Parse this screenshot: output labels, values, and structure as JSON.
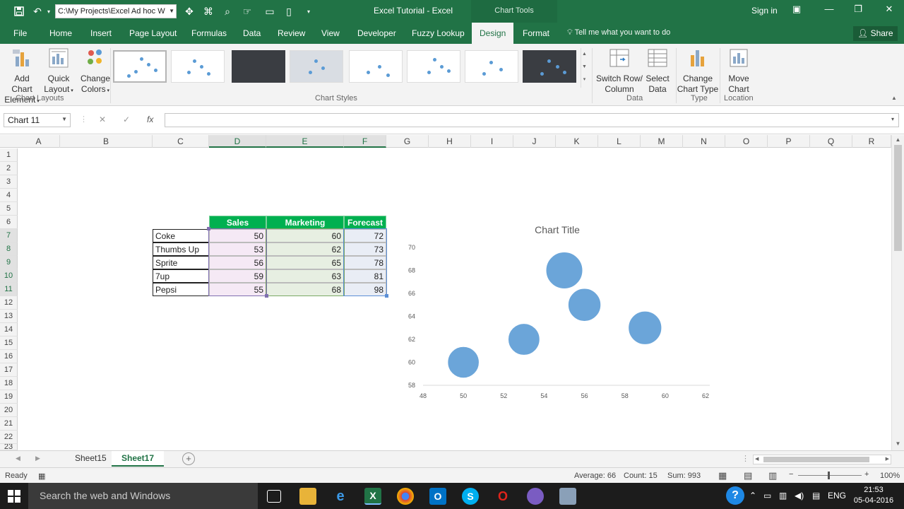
{
  "titlebar": {
    "path": "C:\\My Projects\\Excel Ad hoc W",
    "app_title": "Excel Tutorial  -  Excel",
    "context_title": "Chart Tools",
    "signin": "Sign in"
  },
  "tabs": {
    "items": [
      "File",
      "Home",
      "Insert",
      "Page Layout",
      "Formulas",
      "Data",
      "Review",
      "View",
      "Developer",
      "Fuzzy Lookup",
      "Design",
      "Format"
    ],
    "active": "Design",
    "tellme": "Tell me what you want to do",
    "share": "Share"
  },
  "ribbon": {
    "add_chart_1": "Add Chart",
    "add_chart_2": "Element",
    "quick_layout_1": "Quick",
    "quick_layout_2": "Layout",
    "change_colors_1": "Change",
    "change_colors_2": "Colors",
    "switch_row_1": "Switch Row/",
    "switch_row_2": "Column",
    "select_data_1": "Select",
    "select_data_2": "Data",
    "change_type_1": "Change",
    "change_type_2": "Chart Type",
    "move_chart_1": "Move",
    "move_chart_2": "Chart",
    "group_layouts": "Chart Layouts",
    "group_styles": "Chart Styles",
    "group_data": "Data",
    "group_type": "Type",
    "group_location": "Location"
  },
  "formula": {
    "namebox": "Chart 11",
    "fx": "fx",
    "content": ""
  },
  "columns": [
    "A",
    "B",
    "C",
    "D",
    "E",
    "F",
    "G",
    "H",
    "I",
    "J",
    "K",
    "L",
    "M",
    "N",
    "O",
    "P",
    "Q",
    "R"
  ],
  "rows": [
    "1",
    "2",
    "3",
    "4",
    "5",
    "6",
    "7",
    "8",
    "9",
    "10",
    "11",
    "12",
    "13",
    "14",
    "15",
    "16",
    "17",
    "18",
    "19",
    "20",
    "21",
    "22",
    "23"
  ],
  "table": {
    "headers": [
      "Sales",
      "Marketing",
      "Forecast"
    ],
    "rows": [
      {
        "label": "Coke",
        "sales": "50",
        "marketing": "60",
        "forecast": "72"
      },
      {
        "label": "Thumbs Up",
        "sales": "53",
        "marketing": "62",
        "forecast": "73"
      },
      {
        "label": "Sprite",
        "sales": "56",
        "marketing": "65",
        "forecast": "78"
      },
      {
        "label": "7up",
        "sales": "59",
        "marketing": "63",
        "forecast": "81"
      },
      {
        "label": "Pepsi",
        "sales": "55",
        "marketing": "68",
        "forecast": "98"
      }
    ]
  },
  "chart_data": {
    "type": "bubble",
    "title": "Chart Title",
    "xlabel": "",
    "ylabel": "",
    "xlim": [
      48,
      62
    ],
    "ylim": [
      58,
      70
    ],
    "x_ticks": [
      "48",
      "50",
      "52",
      "54",
      "56",
      "58",
      "60",
      "62"
    ],
    "y_ticks": [
      "58",
      "60",
      "62",
      "64",
      "66",
      "68",
      "70"
    ],
    "points": [
      {
        "x": 50,
        "y": 60,
        "size": 72
      },
      {
        "x": 53,
        "y": 62,
        "size": 73
      },
      {
        "x": 56,
        "y": 65,
        "size": 78
      },
      {
        "x": 59,
        "y": 63,
        "size": 81
      },
      {
        "x": 55,
        "y": 68,
        "size": 98
      }
    ],
    "color": "#5b9bd5",
    "grid": false
  },
  "sheets": {
    "tabs": [
      "Sheet15",
      "Sheet17"
    ],
    "active": "Sheet17"
  },
  "status": {
    "ready": "Ready",
    "average": "Average: 66",
    "count": "Count: 15",
    "sum": "Sum: 993",
    "zoom": "100%"
  },
  "taskbar": {
    "search": "Search the web and Windows",
    "lang": "ENG",
    "time": "21:53",
    "date": "05-04-2016"
  },
  "colors": {
    "excel_green": "#217346",
    "header_green": "#00b050",
    "bubble_blue": "#5b9bd5"
  }
}
